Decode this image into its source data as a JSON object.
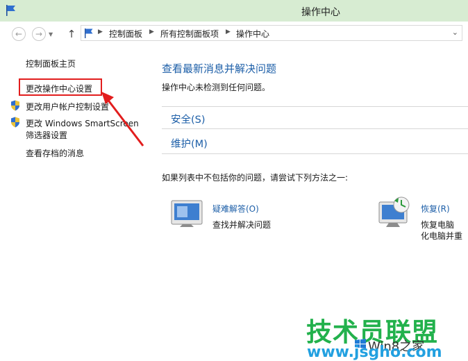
{
  "window": {
    "title": "操作中心"
  },
  "nav": {
    "back_icon": "back-arrow-icon",
    "forward_icon": "forward-arrow-icon",
    "up_icon": "up-arrow-icon"
  },
  "address": {
    "crumbs": [
      "控制面板",
      "所有控制面板项",
      "操作中心"
    ]
  },
  "sidebar": {
    "items": [
      {
        "label": "控制面板主页"
      },
      {
        "label": "更改操作中心设置"
      },
      {
        "label": "更改用户帐户控制设置"
      },
      {
        "label": "更改 Windows SmartScreen",
        "label2": "筛选器设置"
      },
      {
        "label": "查看存档的消息"
      }
    ]
  },
  "main": {
    "heading": "查看最新消息并解决问题",
    "status": "操作中心未检测到任何问题。",
    "sections": [
      {
        "label": "安全(S)"
      },
      {
        "label": "维护(M)"
      }
    ],
    "hint": "如果列表中不包括你的问题，请尝试下列方法之一:",
    "tiles": [
      {
        "title": "疑难解答(O)",
        "desc": "查找并解决问题",
        "icon": "troubleshoot-icon"
      },
      {
        "title": "恢复(R)",
        "desc": "恢复电脑或不影响你的文件的情况下刷新电脑",
        "desc_visible_1": "恢复电脑",
        "desc_visible_2": "化电脑并重",
        "icon": "recovery-icon"
      }
    ]
  },
  "watermark": {
    "line1": "技术员联盟",
    "line2": "Win8之家",
    "line3": "www.jsgho.com"
  },
  "colors": {
    "link_blue": "#1d5fa8",
    "titlebar": "#d7ecd2",
    "highlight_red": "#e21d1d",
    "watermark_green": "#22b14c"
  }
}
